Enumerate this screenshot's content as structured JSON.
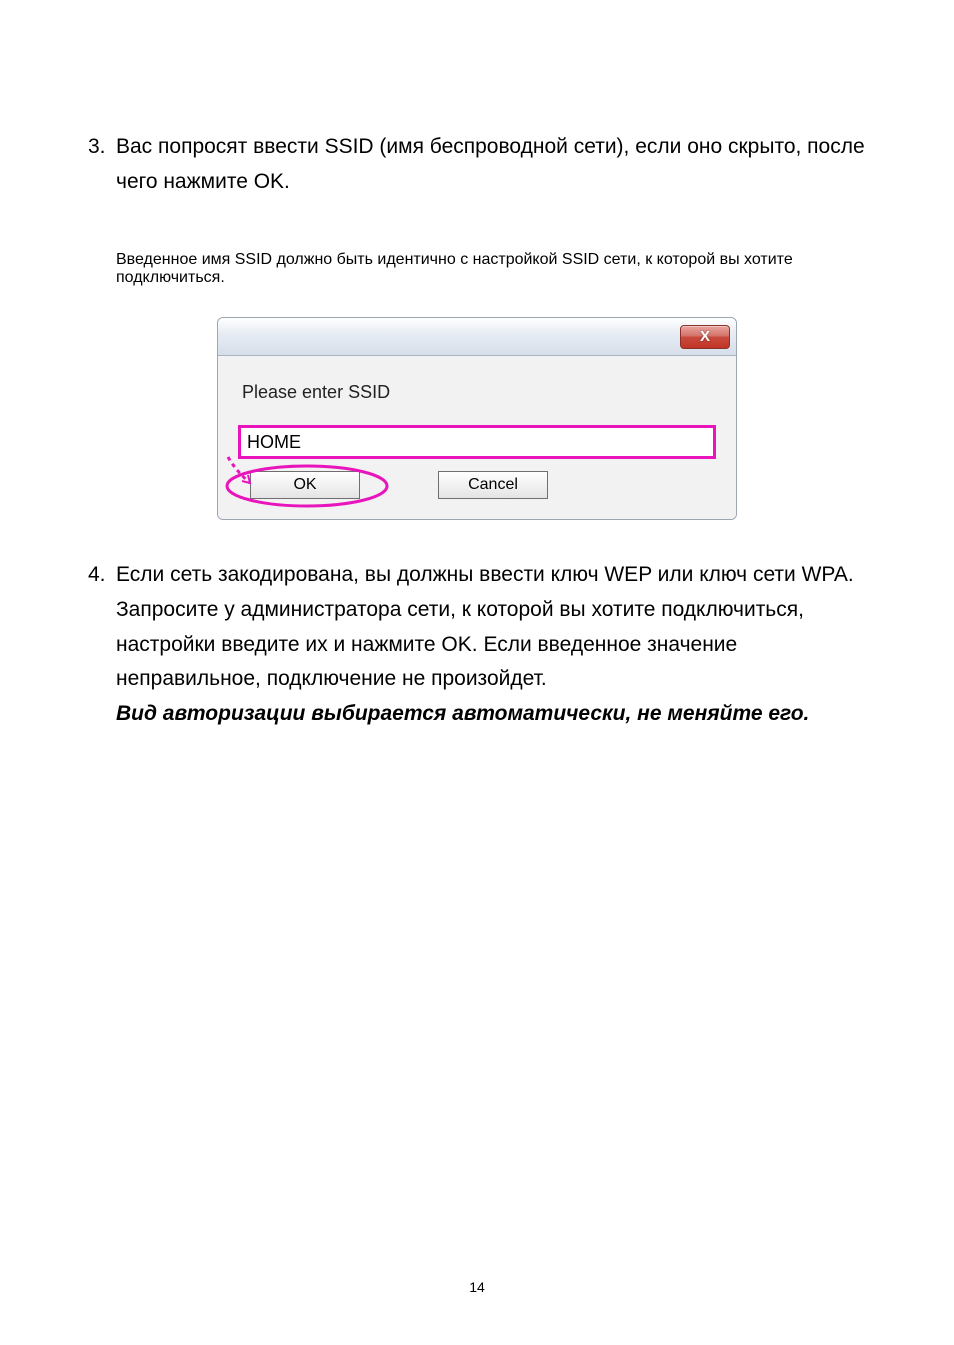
{
  "step3": {
    "number": "3.",
    "text_a": "Вас попросят ввести  SSID (имя беспроводной сети), если оно скрыто, после чего нажмите OK.",
    "text_b": "Введенное имя SSID должно быть идентично с настройкой SSID сети, к которой вы хотите подключиться."
  },
  "dialog": {
    "close": "X",
    "prompt": "Please enter SSID",
    "input_value": "HOME",
    "ok": "OK",
    "cancel": "Cancel"
  },
  "step4": {
    "number": "4.",
    "text": "Если сеть закодирована, вы должны ввести ключ WEP или ключ сети WPA. Запросите у администратора сети, к которой вы хотите подключиться, настройки введите их и нажмите OK. Если введенное значение неправильное, подключение не произойдет.",
    "note": "Вид авторизации выбирается автоматически, не меняйте его."
  },
  "page_number": "14"
}
